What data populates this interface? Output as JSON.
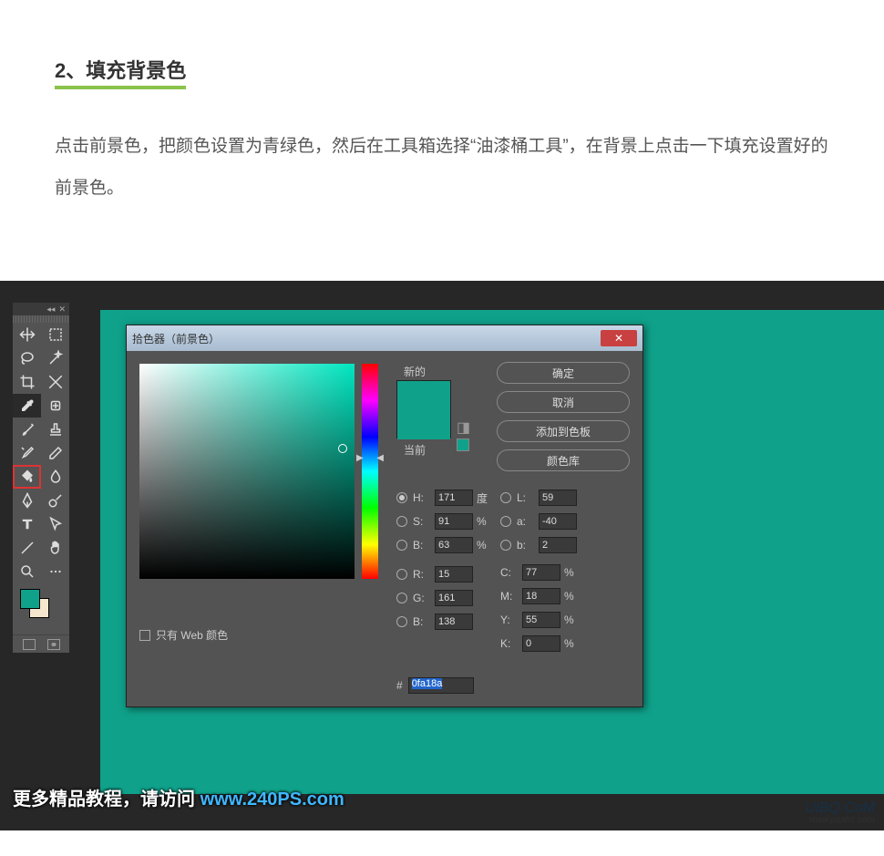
{
  "article": {
    "heading": "2、填充背景色",
    "body": "点击前景色，把颜色设置为青绿色，然后在工具箱选择“油漆桶工具”，在背景上点击一下填充设置好的前景色。"
  },
  "toolbar": {
    "collapse": "◂◂",
    "close": "✕",
    "fg_color": "#0fa18a",
    "bg_color": "#f5e6ce"
  },
  "dialog": {
    "title": "拾色器（前景色）",
    "close": "✕",
    "preview_new_label": "新的",
    "preview_cur_label": "当前",
    "buttons": {
      "ok": "确定",
      "cancel": "取消",
      "add": "添加到色板",
      "lib": "颜色库"
    },
    "fields": {
      "H": {
        "label": "H:",
        "value": "171",
        "unit": "度"
      },
      "S": {
        "label": "S:",
        "value": "91",
        "unit": "%"
      },
      "Bv": {
        "label": "B:",
        "value": "63",
        "unit": "%"
      },
      "R": {
        "label": "R:",
        "value": "15"
      },
      "G": {
        "label": "G:",
        "value": "161"
      },
      "B": {
        "label": "B:",
        "value": "138"
      },
      "L": {
        "label": "L:",
        "value": "59"
      },
      "a": {
        "label": "a:",
        "value": "-40"
      },
      "bb": {
        "label": "b:",
        "value": "2"
      },
      "C": {
        "label": "C:",
        "value": "77",
        "unit": "%"
      },
      "M": {
        "label": "M:",
        "value": "18",
        "unit": "%"
      },
      "Y": {
        "label": "Y:",
        "value": "55",
        "unit": "%"
      },
      "K": {
        "label": "K:",
        "value": "0",
        "unit": "%"
      },
      "hex_prefix": "#",
      "hex": "0fa18a"
    },
    "web_only": "只有 Web 颜色"
  },
  "footer": {
    "text1": "更多精品教程，请访问 ",
    "url": "www.240PS.com"
  },
  "watermark": {
    "main": "UiBQ.CoM",
    "sub": "www.psahz.com"
  }
}
